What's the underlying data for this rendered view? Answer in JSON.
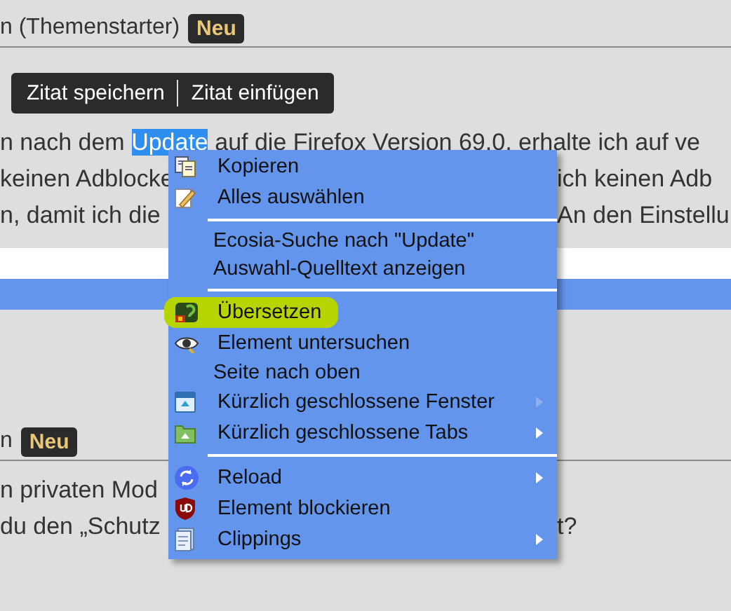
{
  "posts": [
    {
      "author": "n (Themenstarter)",
      "badge": "Neu",
      "quote_toolbar": [
        "Zitat speichern",
        "Zitat einfügen"
      ],
      "lines": [
        {
          "segments": [
            {
              "text": "n nach dem ",
              "selected": false
            },
            {
              "text": "Update",
              "selected": true
            },
            {
              "text": " auf die Firefox Version 69.0, erhalte ich auf ve",
              "selected": false
            }
          ]
        },
        {
          "segments": [
            {
              "text": "keinen Adblocke",
              "selected": false
            }
          ],
          "right": "ich keinen Adb"
        },
        {
          "segments": [
            {
              "text": "n, damit ich die",
              "selected": false
            }
          ],
          "right": "An den Einstellu"
        }
      ],
      "bands": [
        {
          "kind": "field"
        },
        {
          "kind": "selection"
        }
      ]
    },
    {
      "author": "n",
      "badge": "Neu",
      "lines": [
        {
          "segments": [
            {
              "text": "n privaten Mod",
              "selected": false
            }
          ]
        },
        {
          "segments": [
            {
              "text": "du den „Schutz",
              "selected": false
            }
          ],
          "right": "t?"
        }
      ]
    }
  ],
  "context_menu": [
    {
      "kind": "copy",
      "label": "Kopieren",
      "submenu": false,
      "highlighted": false
    },
    {
      "kind": "select",
      "label": "Alles auswählen",
      "submenu": false,
      "highlighted": false
    },
    {
      "kind": "separator"
    },
    {
      "kind": "text",
      "label": "Ecosia-Suche nach \"Update\"",
      "submenu": false,
      "highlighted": false
    },
    {
      "kind": "text",
      "label": "Auswahl-Quelltext anzeigen",
      "submenu": false,
      "highlighted": false
    },
    {
      "kind": "separator"
    },
    {
      "kind": "translate",
      "label": "Übersetzen",
      "submenu": false,
      "highlighted": true
    },
    {
      "kind": "eye",
      "label": "Element untersuchen",
      "submenu": false,
      "highlighted": false
    },
    {
      "kind": "text",
      "label": "Seite nach oben",
      "submenu": false,
      "highlighted": false
    },
    {
      "kind": "window",
      "label": "Kürzlich geschlossene Fenster",
      "submenu": true,
      "submenu_empty": true,
      "highlighted": false
    },
    {
      "kind": "tabs",
      "label": "Kürzlich geschlossene Tabs",
      "submenu": true,
      "submenu_empty": false,
      "highlighted": false
    },
    {
      "kind": "separator"
    },
    {
      "kind": "reload",
      "label": "Reload",
      "submenu": true,
      "submenu_empty": false,
      "highlighted": false
    },
    {
      "kind": "shield",
      "label": "Element blockieren",
      "submenu": false,
      "highlighted": false
    },
    {
      "kind": "clippings",
      "label": "Clippings",
      "submenu": true,
      "submenu_empty": false,
      "highlighted": false
    }
  ]
}
